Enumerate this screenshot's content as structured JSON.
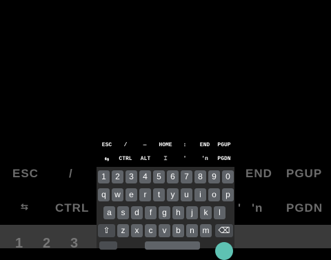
{
  "background": {
    "row1": [
      "ESC",
      "/",
      "END",
      "PGUP"
    ],
    "row2": [
      "⇆",
      "CTRL",
      "'",
      "'n",
      "PGDN"
    ],
    "row3": [
      "1",
      "2",
      "3"
    ]
  },
  "extra_keys": {
    "row1": [
      "ESC",
      "/",
      "—",
      "HOME",
      "↕",
      "END",
      "PGUP"
    ],
    "row2": [
      "⇆",
      "CTRL",
      "ALT",
      "⌶",
      "'",
      "'n",
      "PGDN"
    ]
  },
  "keyboard": {
    "row1": [
      "1",
      "2",
      "3",
      "4",
      "5",
      "6",
      "7",
      "8",
      "9",
      "0"
    ],
    "row2": [
      "q",
      "w",
      "e",
      "r",
      "t",
      "y",
      "u",
      "i",
      "o",
      "p"
    ],
    "row3": [
      "a",
      "s",
      "d",
      "f",
      "g",
      "h",
      "j",
      "k",
      "l"
    ],
    "row4": [
      "⇧",
      "z",
      "x",
      "c",
      "v",
      "b",
      "n",
      "m",
      "⌫"
    ]
  },
  "colors": {
    "key": "#5f6368",
    "keyboard_bg": "#2b2b2b",
    "accent": "#5ec2b3"
  }
}
